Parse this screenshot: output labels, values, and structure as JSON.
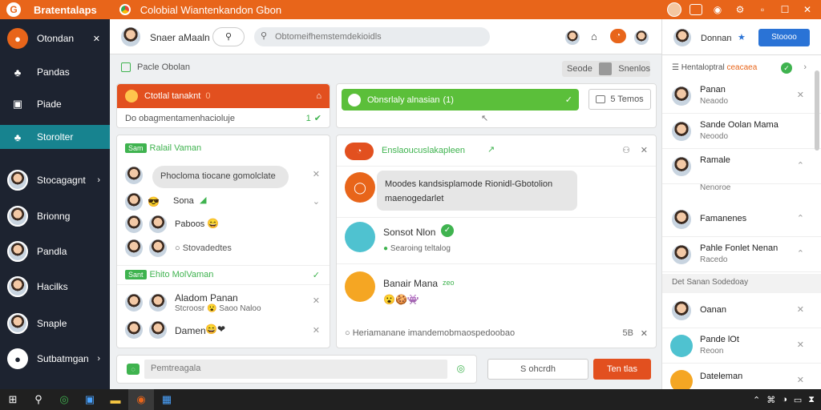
{
  "titlebar": {
    "app_name": "Bratentalaps",
    "window_title": "Colobial Wiantenkandon Gbon",
    "icon": "chrome-icon"
  },
  "sidebar": {
    "items": [
      {
        "label": "Otondan",
        "icon": "user-icon"
      },
      {
        "label": "Pandas",
        "icon": "group-icon"
      },
      {
        "label": "Piade",
        "icon": "page-icon"
      },
      {
        "label": "Storolter",
        "icon": "people-icon"
      },
      {
        "label": "Stocagagnt",
        "icon": "avatar"
      },
      {
        "label": "Brionng",
        "icon": "avatar"
      },
      {
        "label": "Pandla",
        "icon": "avatar"
      },
      {
        "label": "Hacilks",
        "icon": "avatar"
      },
      {
        "label": "Snaple",
        "icon": "avatar"
      },
      {
        "label": "Sutbatmgan",
        "icon": "profile-icon"
      }
    ]
  },
  "topbar": {
    "user_name": "Snaer aMaaln",
    "search_placeholder": "Obtomeifhemstemdekioidls"
  },
  "content": {
    "breadcrumb": "Pacle Obolan",
    "filter_label": "Seode",
    "filter_value": "Snenlos",
    "left_card": {
      "header": "Ctotlal tanaknt",
      "header_count": "0",
      "sub": "Do obagmentamenhacioluje",
      "sub_count": "1",
      "group1_tag": "Sam",
      "group1": "Ralail Vaman",
      "bubble": "Phocloma tiocane gomolclate",
      "rows": [
        {
          "name": "Sona"
        },
        {
          "name": "Paboos"
        },
        {
          "name": "Stovadedtes"
        }
      ],
      "group2_tag": "Sant",
      "group2": "Ehito MolVaman",
      "rows2": [
        {
          "name": "Aladom Panan",
          "sub": "Stcroosr",
          "sub2": "Saoo Naloo"
        },
        {
          "name": "Damen"
        }
      ]
    },
    "middle_top": {
      "label": "Obnsrlaly alnasian",
      "label_suffix": "(1)",
      "button": "5 Temos"
    },
    "middle_card": {
      "header": "Enslaoucuslakapleen",
      "bubble_line1": "Moodes kandsisplamode Rionidl-Gbotolion",
      "bubble_line2": "maenogedarlet",
      "row1_name": "Sonsot Nlon",
      "row1_sub": "Searoing teltalog",
      "row2_name": "Banair Mana",
      "row2_tag": "zeo",
      "footer": "Heriamanane imandemobmaospedoobao",
      "footer_right": "5B"
    },
    "compose_placeholder": "Pemtreagala",
    "search_button": "S ohcrdh",
    "send_button": "Ten tlas"
  },
  "right_panel": {
    "user_name": "Donnan",
    "action_button": "Stoooo",
    "section_title": "Hentaloptral",
    "section_link": "ceacaea",
    "rows": [
      {
        "name": "Panan",
        "sub": "Neaodo"
      },
      {
        "name": "Sande Oolan Mama",
        "sub": "Neoodo"
      },
      {
        "name": "Ramale",
        "sub": "Nenoroe"
      },
      {
        "name": "Famanenes",
        "sub": ""
      },
      {
        "name": "Pahle Fonlet Nenan",
        "sub": "Racedo"
      }
    ],
    "section2_title": "Det Sanan Sodedoay",
    "rows2": [
      {
        "name": "Oanan",
        "sub": ""
      },
      {
        "name": "Pande lOt",
        "sub": "Reoon"
      },
      {
        "name": "Dateleman",
        "sub": ""
      }
    ]
  },
  "colors": {
    "accent": "#e8651a",
    "teal": "#17838f",
    "green": "#5bbf3a",
    "blue": "#2a73d6"
  }
}
